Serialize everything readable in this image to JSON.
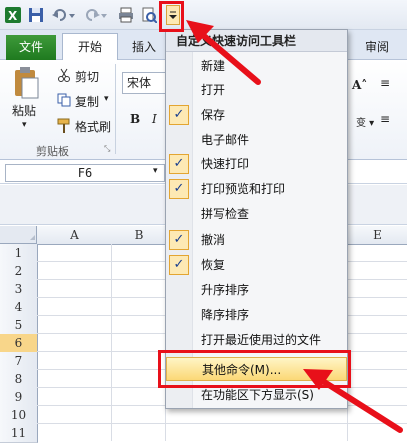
{
  "quick_access": {
    "icons": [
      "excel-icon",
      "save-icon",
      "undo-icon",
      "redo-icon",
      "print-icon",
      "print-preview-icon",
      "customize-dropdown-icon"
    ]
  },
  "ribbon": {
    "tabs": {
      "file": "文件",
      "home": "开始",
      "insert": "插入",
      "review": "审阅"
    },
    "clipboard": {
      "paste": "粘贴",
      "cut": "剪切",
      "copy": "复制",
      "format_painter": "格式刷",
      "group_label": "剪贴板"
    },
    "font": {
      "name": "宋体",
      "bold": "B",
      "italic": "I"
    }
  },
  "formula_bar": {
    "cell_ref": "F6"
  },
  "grid": {
    "columns": [
      "A",
      "B",
      "E"
    ],
    "rows": [
      "1",
      "2",
      "3",
      "4",
      "5",
      "6",
      "7",
      "8",
      "9",
      "10",
      "11"
    ],
    "selected_row": "6"
  },
  "menu": {
    "title": "自定义快速访问工具栏",
    "items": [
      {
        "label": "新建",
        "checked": false
      },
      {
        "label": "打开",
        "checked": false
      },
      {
        "label": "保存",
        "checked": true
      },
      {
        "label": "电子邮件",
        "checked": false
      },
      {
        "label": "快速打印",
        "checked": true
      },
      {
        "label": "打印预览和打印",
        "checked": true
      },
      {
        "label": "拼写检查",
        "checked": false
      },
      {
        "label": "撤消",
        "checked": true
      },
      {
        "label": "恢复",
        "checked": true
      },
      {
        "label": "升序排序",
        "checked": false
      },
      {
        "label": "降序排序",
        "checked": false
      },
      {
        "label": "打开最近使用过的文件",
        "checked": false
      },
      {
        "label": "其他命令(M)...",
        "checked": false,
        "highlighted": true
      },
      {
        "label": "在功能区下方显示(S)",
        "checked": false
      }
    ],
    "check_mark": "✓"
  },
  "colors": {
    "annotation": "#e8101a",
    "highlight": "#fbd876",
    "file_tab": "#2a8a2a"
  }
}
